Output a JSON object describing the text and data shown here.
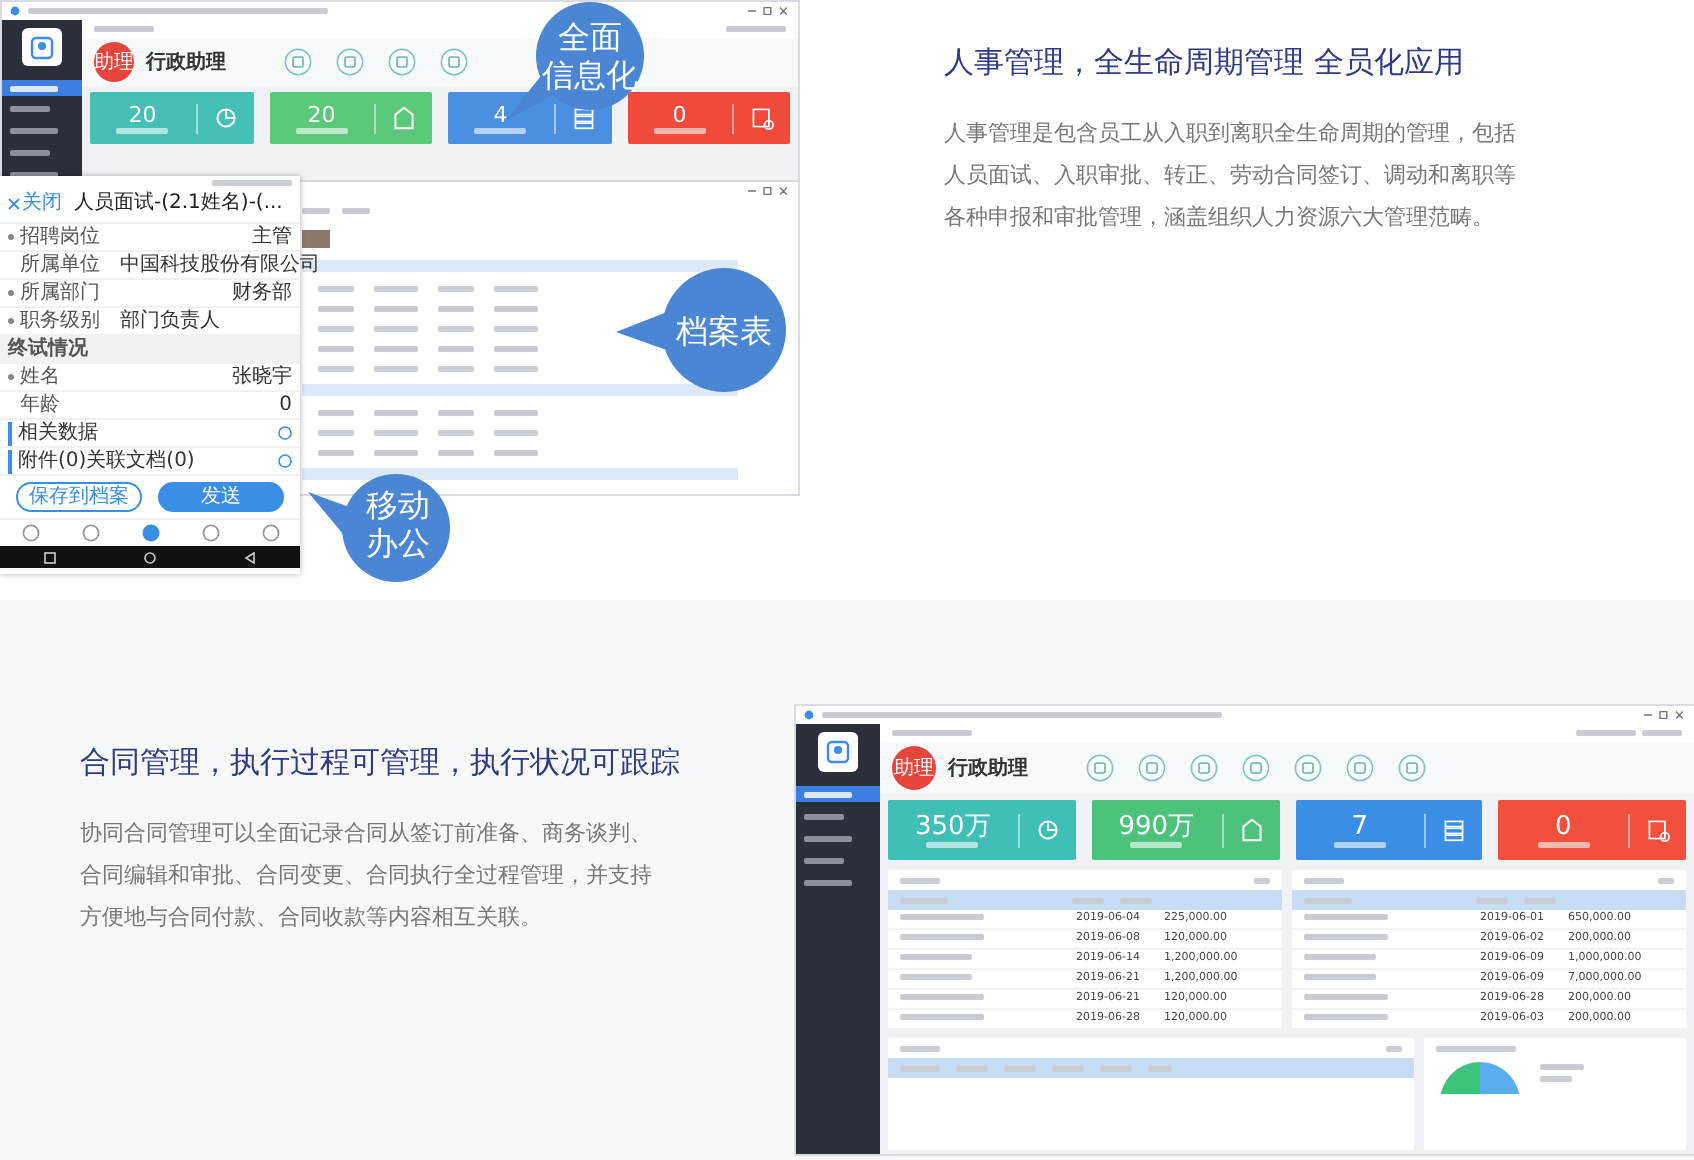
{
  "hr_section": {
    "title": "人事管理，全生命周期管理 全员化应用",
    "description": "人事管理是包含员工从入职到离职全生命周期的管理，包括人员面试、入职审批、转正、劳动合同签订、调动和离职等各种申报和审批管理，涵盖组织人力资源六大管理范畴。",
    "desktop": {
      "sidebar": [
        {
          "selected": true
        },
        {
          "selected": false
        },
        {
          "selected": false
        },
        {
          "selected": false
        },
        {
          "selected": false
        }
      ],
      "badge": "助理",
      "app_title": "行政助理",
      "stats": [
        {
          "value": "20",
          "color": "#45c0b5"
        },
        {
          "value": "20",
          "color": "#5cc97a"
        },
        {
          "value": "4",
          "color": "#4a8fe0"
        },
        {
          "value": "0",
          "color": "#f04a3a"
        }
      ]
    },
    "mobile": {
      "close": "关闭",
      "title": "人员面试-(2.1姓名)-(...",
      "rows": [
        {
          "kind": "field",
          "required": true,
          "label": "招聘岗位",
          "value": "主管"
        },
        {
          "kind": "field",
          "required": false,
          "label": "所属单位",
          "value": "中国科技股份有限公司"
        },
        {
          "kind": "field",
          "required": true,
          "label": "所属部门",
          "value": "财务部"
        },
        {
          "kind": "field",
          "required": true,
          "label": "职务级别",
          "value": "部门负责人"
        },
        {
          "kind": "heading",
          "label": "终试情况"
        },
        {
          "kind": "field",
          "required": true,
          "label": "姓名",
          "value": "张晓宇"
        },
        {
          "kind": "field",
          "required": false,
          "label": "年龄",
          "value": "0"
        },
        {
          "kind": "link",
          "label": "相关数据"
        },
        {
          "kind": "link",
          "label": "附件(0)关联文档(0)"
        }
      ],
      "buttons": [
        {
          "kind": "outline",
          "label": "保存到档案"
        },
        {
          "kind": "primary",
          "label": "发送"
        }
      ],
      "nav": [
        {
          "selected": false
        },
        {
          "selected": false
        },
        {
          "selected": true
        },
        {
          "selected": false
        },
        {
          "selected": false
        }
      ]
    },
    "callouts": [
      {
        "lines": [
          "全面",
          "信息化"
        ]
      },
      {
        "lines": [
          "档案表"
        ]
      },
      {
        "lines": [
          "移动",
          "办公"
        ]
      }
    ]
  },
  "contract_section": {
    "title": "合同管理，执行过程可管理，执行状况可跟踪",
    "description": "协同合同管理可以全面记录合同从签订前准备、商务谈判、合同编辑和审批、合同变更、合同执行全过程管理，并支持方便地与合同付款、合同收款等内容相互关联。",
    "app": {
      "sidebar": [
        {
          "selected": true
        },
        {
          "selected": false
        },
        {
          "selected": false
        },
        {
          "selected": false
        },
        {
          "selected": false
        }
      ],
      "badge": "助理",
      "app_title": "行政助理",
      "stats": [
        {
          "value": "350万",
          "color": "#3fbfb5"
        },
        {
          "value": "990万",
          "color": "#4cc27a"
        },
        {
          "value": "7",
          "color": "#3a8ee6"
        },
        {
          "value": "0",
          "color": "#f0503c"
        }
      ],
      "tables": [
        {
          "rows": [
            {
              "date": "2019-06-04",
              "amount": "225,000.00"
            },
            {
              "date": "2019-06-08",
              "amount": "120,000.00"
            },
            {
              "date": "2019-06-14",
              "amount": "1,200,000.00"
            },
            {
              "date": "2019-06-21",
              "amount": "1,200,000.00"
            },
            {
              "date": "2019-06-21",
              "amount": "120,000.00"
            },
            {
              "date": "2019-06-28",
              "amount": "120,000.00"
            }
          ]
        },
        {
          "rows": [
            {
              "date": "2019-06-01",
              "amount": "650,000.00"
            },
            {
              "date": "2019-06-02",
              "amount": "200,000.00"
            },
            {
              "date": "2019-06-09",
              "amount": "1,000,000.00"
            },
            {
              "date": "2019-06-09",
              "amount": "7,000,000.00"
            },
            {
              "date": "2019-06-28",
              "amount": "200,000.00"
            },
            {
              "date": "2019-06-03",
              "amount": "200,000.00"
            }
          ]
        }
      ]
    }
  }
}
